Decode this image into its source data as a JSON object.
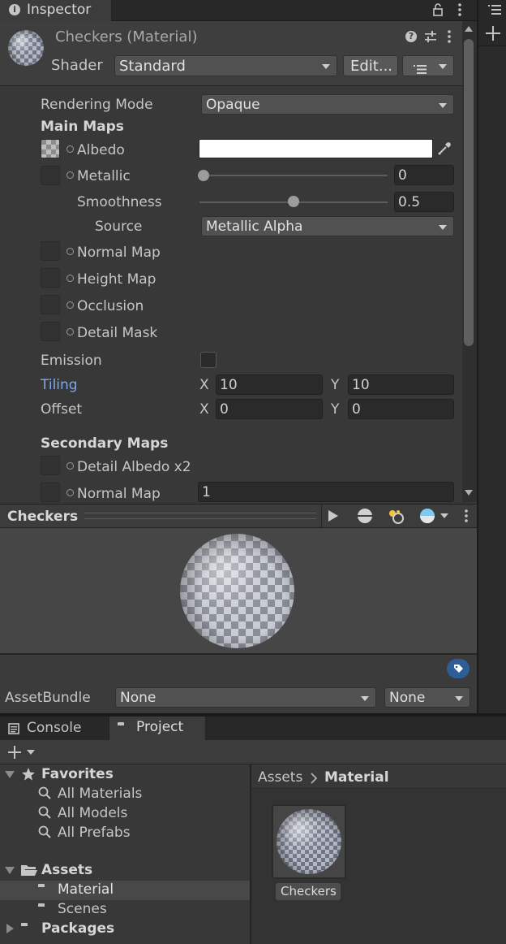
{
  "inspector": {
    "tab_label": "Inspector",
    "material_title": "Checkers (Material)",
    "shader_label": "Shader",
    "shader_value": "Standard",
    "edit_button": "Edit...",
    "rendering_mode_label": "Rendering Mode",
    "rendering_mode_value": "Opaque",
    "main_maps_label": "Main Maps",
    "albedo_label": "Albedo",
    "albedo_color": "#ffffff",
    "metallic_label": "Metallic",
    "metallic_value": "0",
    "smoothness_label": "Smoothness",
    "smoothness_value": "0.5",
    "source_label": "Source",
    "source_value": "Metallic Alpha",
    "normal_map_label": "Normal Map",
    "height_map_label": "Height Map",
    "occlusion_label": "Occlusion",
    "detail_mask_label": "Detail Mask",
    "emission_label": "Emission",
    "tiling_label": "Tiling",
    "tiling_x": "10",
    "tiling_y": "10",
    "offset_label": "Offset",
    "offset_x": "0",
    "offset_y": "0",
    "x_label": "X",
    "y_label": "Y",
    "secondary_maps_label": "Secondary Maps",
    "detail_albedo_label": "Detail Albedo x2",
    "secondary_normal_label": "Normal Map",
    "secondary_normal_value": "1",
    "tiling_color": "#7fa7e8"
  },
  "preview": {
    "title": "Checkers"
  },
  "asset_bundle": {
    "label": "AssetBundle",
    "bundle_value": "None",
    "variant_value": "None"
  },
  "bottom_tabs": {
    "console": "Console",
    "project": "Project"
  },
  "project": {
    "favorites_label": "Favorites",
    "favorites": [
      "All Materials",
      "All Models",
      "All Prefabs"
    ],
    "assets_label": "Assets",
    "asset_folders": [
      "Material",
      "Scenes"
    ],
    "packages_label": "Packages",
    "breadcrumb_root": "Assets",
    "breadcrumb_current": "Material",
    "grid_item_label": "Checkers"
  }
}
